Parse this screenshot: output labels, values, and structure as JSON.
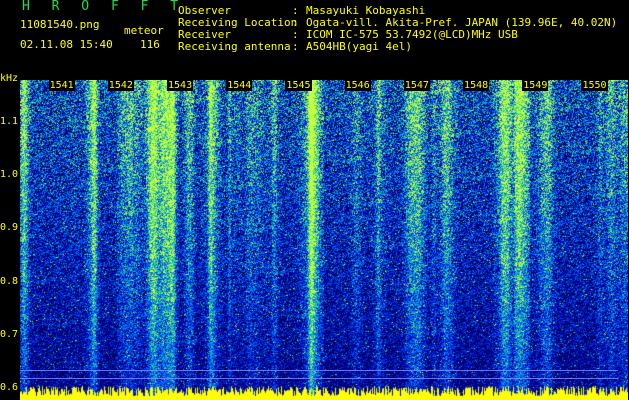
{
  "header": {
    "app_title": "H R O F F T",
    "file_name": "11081540.png",
    "mode": "meteor",
    "datetime": "02.11.08 15:40",
    "count": "116"
  },
  "info": [
    {
      "label": "Observer",
      "sep": ":",
      "value": "Masayuki Kobayashi"
    },
    {
      "label": "Receiving Location",
      "sep": ":",
      "value": "Ogata-vill. Akita-Pref. JAPAN (139.96E, 40.02N)"
    },
    {
      "label": "Receiver",
      "sep": ":",
      "value": "ICOM IC-575 53.7492(@LCD)MHz USB"
    },
    {
      "label": "Receiving antenna",
      "sep": ":",
      "value": "A504HB(yagi 4el)"
    }
  ],
  "chart_data": {
    "type": "heatmap",
    "ylabel": "kHz",
    "y_ticks": [
      "1.1",
      "1.0",
      "0.9",
      "0.8",
      "0.7",
      "0.6"
    ],
    "y_tick_values": [
      1.1,
      1.0,
      0.9,
      0.8,
      0.7,
      0.6
    ],
    "ylim": [
      0.58,
      1.18
    ],
    "x_ticks": [
      "1541",
      "1542",
      "1543",
      "1544",
      "1545",
      "1546",
      "1547",
      "1548",
      "1549",
      "1550"
    ],
    "x_tick_values": [
      1541,
      1542,
      1543,
      1544,
      1545,
      1546,
      1547,
      1548,
      1549,
      1550
    ],
    "xlim": [
      1540.5,
      1550.6
    ],
    "colors": {
      "low": "#00008b",
      "mid": "#0050ff",
      "high": "#22ff88",
      "peak": "#ffff00"
    }
  }
}
